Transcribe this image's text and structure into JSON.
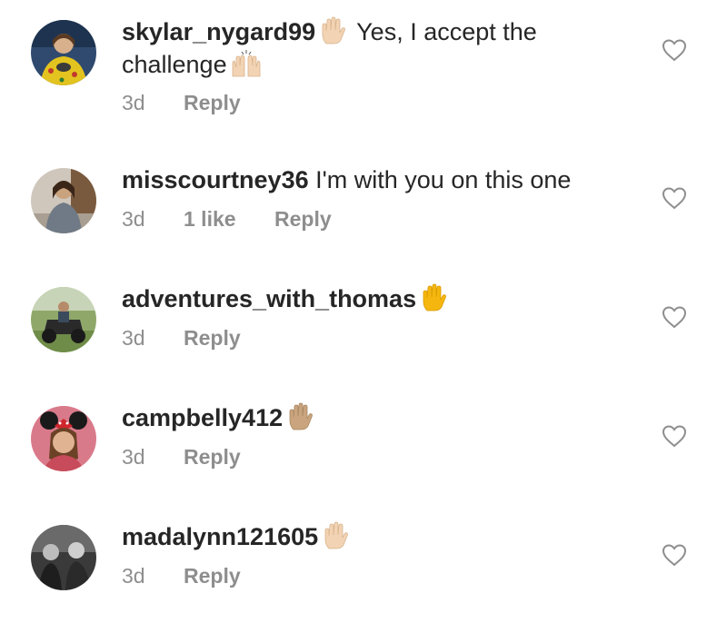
{
  "comments": [
    {
      "username": "skylar_nygard99",
      "text": "Yes, I accept the",
      "text_line2": "challenge",
      "age": "3d",
      "likes": "",
      "reply_label": "Reply",
      "emojis": [
        "raised-hand-light",
        "raising-hands-light"
      ]
    },
    {
      "username": "misscourtney36",
      "text": "I'm with you on this one",
      "age": "3d",
      "likes": "1 like",
      "reply_label": "Reply",
      "emojis": []
    },
    {
      "username": "adventures_with_thomas",
      "text": "",
      "age": "3d",
      "likes": "",
      "reply_label": "Reply",
      "emojis": [
        "raised-hand-yellow"
      ]
    },
    {
      "username": "campbelly412",
      "text": "",
      "age": "3d",
      "likes": "",
      "reply_label": "Reply",
      "emojis": [
        "raised-hand-medium"
      ]
    },
    {
      "username": "madalynn121605",
      "text": "",
      "age": "3d",
      "likes": "",
      "reply_label": "Reply",
      "emojis": [
        "raised-hand-light"
      ]
    }
  ],
  "colors": {
    "text": "#262626",
    "meta": "#8e8e8e",
    "heart_outline": "#8e8e8e",
    "skin_light": "#f2d3b3",
    "skin_medium": "#c9a47e",
    "skin_yellow": "#f5b70f"
  },
  "icons": {
    "like": "heart-outline-icon"
  }
}
